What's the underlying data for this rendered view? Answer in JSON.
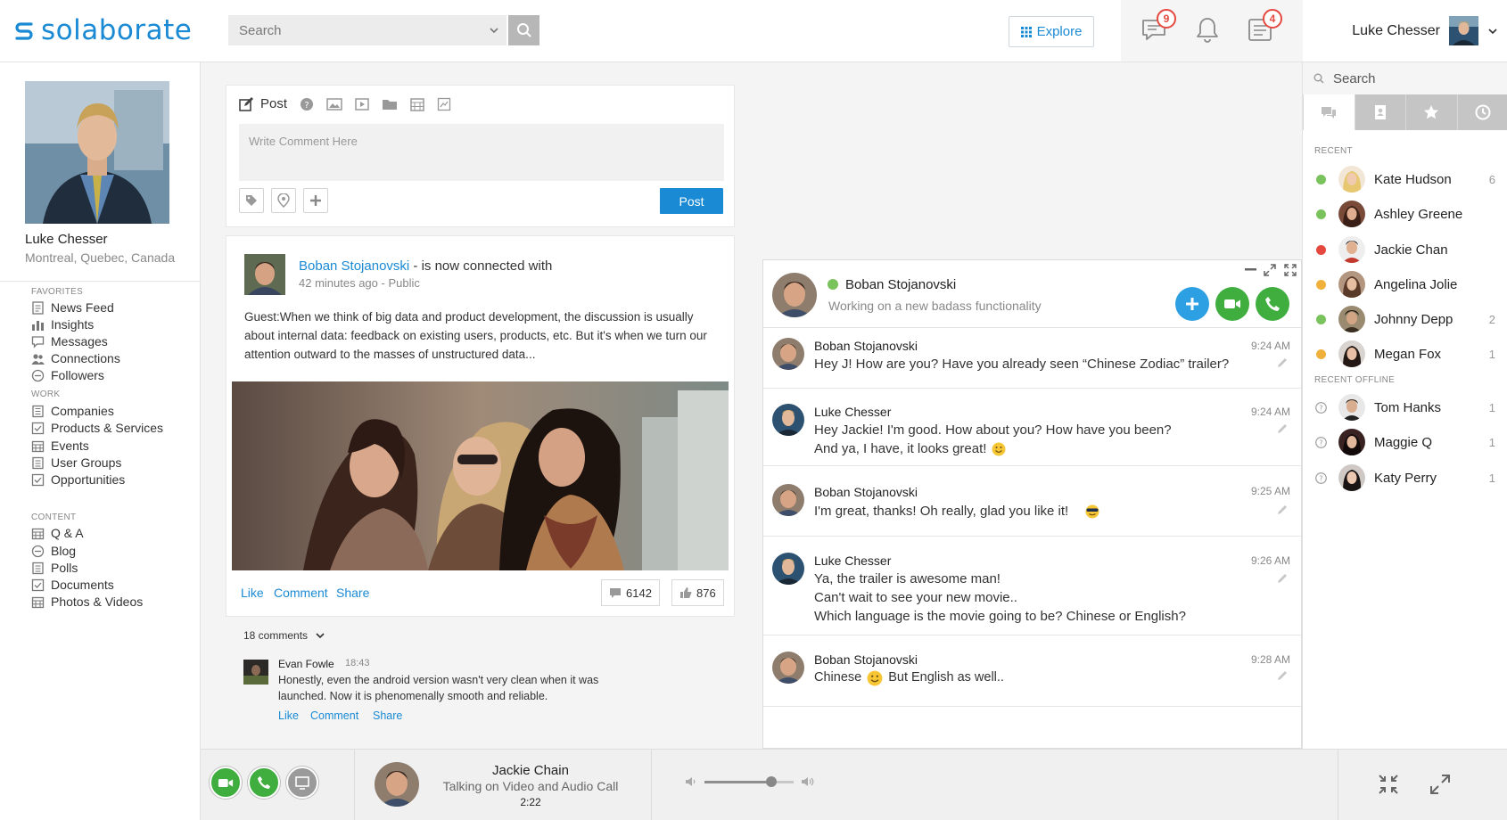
{
  "header": {
    "logo_text": "solaborate",
    "search_placeholder": "Search",
    "explore_label": "Explore",
    "messages_badge": "9",
    "notifications_badge": "",
    "tasks_badge": "4",
    "user_name": "Luke Chesser"
  },
  "profile": {
    "name": "Luke Chesser",
    "location": "Montreal, Quebec, Canada"
  },
  "nav": {
    "favorites_title": "FAVORITES",
    "favorites": [
      "News Feed",
      "Insights",
      "Messages",
      "Connections",
      "Followers"
    ],
    "work_title": "WORK",
    "work": [
      "Companies",
      "Products & Services",
      "Events",
      "User Groups",
      "Opportunities"
    ],
    "content_title": "CONTENT",
    "content": [
      "Q & A",
      "Blog",
      "Polls",
      "Documents",
      "Photos & Videos"
    ]
  },
  "composer": {
    "post_tab": "Post",
    "placeholder": "Write Comment Here",
    "post_button": "Post"
  },
  "post": {
    "author": "Boban Stojanovski",
    "action_text": " - is now connected with",
    "time": "42 minutes ago",
    "visibility": "Public",
    "text": "Guest:When we think of big data and product development, the discussion is usually about internal data: feedback on existing users, products, etc. But it's when we turn our attention outward to the masses of unstructured data...",
    "like_label": "Like",
    "comment_label": "Comment",
    "share_label": "Share",
    "comments_count": "6142",
    "likes_count": "876"
  },
  "comments": {
    "toggle_label": "18 comments",
    "items": [
      {
        "author": "Evan Fowle",
        "time": "18:43",
        "text": "Honestly, even the android version wasn't very clean when it was launched. Now it is phenomenally smooth and reliable.",
        "like_label": "Like",
        "comment_label": "Comment",
        "share_label": "Share"
      }
    ]
  },
  "chat": {
    "contact_name": "Boban Stojanovski",
    "contact_status": "Working on a new badass functionality",
    "messages": [
      {
        "author": "Boban Stojanovski",
        "time": "9:24 AM",
        "lines": [
          "Hey J! How are you? Have you already seen “Chinese Zodiac” trailer?"
        ]
      },
      {
        "author": "Luke Chesser",
        "time": "9:24 AM",
        "lines": [
          "Hey Jackie! I'm good. How about you? How have you been?",
          "And ya, I have, it looks great!"
        ]
      },
      {
        "author": "Boban Stojanovski",
        "time": "9:25 AM",
        "lines": [
          "I'm great, thanks! Oh really, glad you like it!"
        ]
      },
      {
        "author": "Luke Chesser",
        "time": "9:26 AM",
        "lines": [
          "Ya, the trailer is awesome man!",
          "Can't wait to see your new movie..",
          "Which language is the movie going to be? Chinese or English?"
        ]
      },
      {
        "author": "Boban Stojanovski",
        "time": "9:28 AM",
        "lines": [
          "Chinese",
          "But English as well.."
        ]
      }
    ]
  },
  "contacts": {
    "search_placeholder": "Search",
    "recent_title": "RECENT",
    "recent": [
      {
        "name": "Kate Hudson",
        "count": "6",
        "status": "online",
        "color": "#7ac25b"
      },
      {
        "name": "Ashley Greene",
        "count": "",
        "status": "online",
        "color": "#7ac25b"
      },
      {
        "name": "Jackie Chan",
        "count": "",
        "status": "busy",
        "color": "#e5483f"
      },
      {
        "name": "Angelina Jolie",
        "count": "",
        "status": "away",
        "color": "#f0b13c"
      },
      {
        "name": "Johnny Depp",
        "count": "2",
        "status": "online",
        "color": "#7ac25b"
      },
      {
        "name": "Megan Fox",
        "count": "1",
        "status": "away",
        "color": "#f0b13c"
      }
    ],
    "offline_title": "RECENT OFFLINE",
    "offline": [
      {
        "name": "Tom Hanks",
        "count": "1"
      },
      {
        "name": "Maggie Q",
        "count": "1"
      },
      {
        "name": "Katy Perry",
        "count": "1"
      }
    ]
  },
  "call": {
    "name": "Jackie Chain",
    "status": "Talking on Video and Audio Call",
    "timer": "2:22",
    "volume": 0.75
  },
  "colors": {
    "accent": "#1a8ad4",
    "call_green": "#3fae3f",
    "add_blue": "#2d9fe3"
  }
}
